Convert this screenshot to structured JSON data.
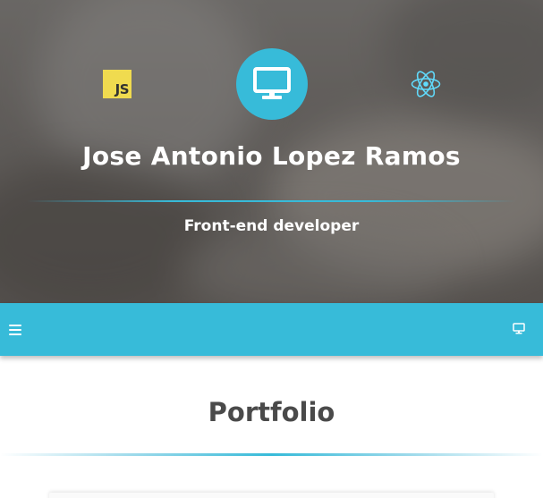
{
  "hero": {
    "name": "Jose Antonio Lopez Ramos",
    "role": "Front-end developer",
    "js_logo_text": "JS",
    "icons": [
      "javascript-logo",
      "monitor-icon",
      "react-logo"
    ]
  },
  "navbar": {
    "menu_icon": "hamburger-menu-icon",
    "right_icon": "monitor-icon"
  },
  "portfolio": {
    "title": "Portfolio"
  },
  "colors": {
    "accent": "#37bbd9",
    "js_yellow": "#f0db4f",
    "title_text": "#4a4a4a"
  }
}
